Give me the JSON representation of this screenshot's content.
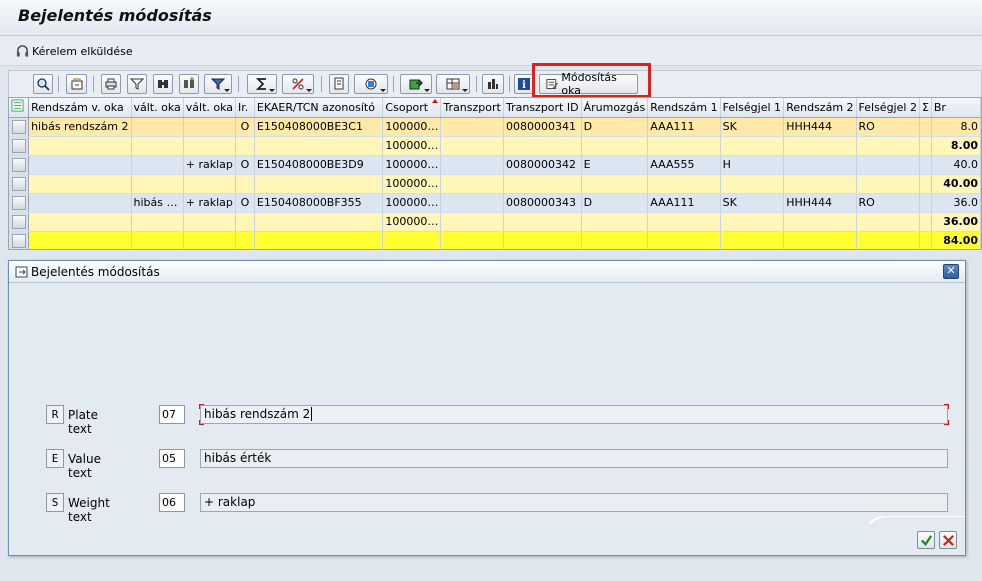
{
  "window": {
    "title": "Bejelentés módosítás"
  },
  "app_toolbar": {
    "send_request": "Kérelem elküldése"
  },
  "alv_toolbar": {
    "modify_reason_button": "Módosítás oka"
  },
  "grid": {
    "columns": [
      "Rendszám v. oka",
      "vált. oka",
      "vált. oka",
      "Ir.",
      "EKAER/TCN azonosító",
      "Csoport",
      "Transzport",
      "Transzport ID",
      "Árumozgás",
      "Rendszám 1",
      "Felségjel 1",
      "Rendszám 2",
      "Felségjel 2",
      "Σ",
      "Br"
    ],
    "rows": [
      {
        "type": "data",
        "current": true,
        "cells": [
          "hibás rendszám 2",
          "",
          "",
          "O",
          "E150408000BE3C1",
          "100000…",
          "",
          "0080000341",
          "D",
          "AAA111",
          "SK",
          "HHH444",
          "RO",
          "",
          "8.0"
        ]
      },
      {
        "type": "subtotal",
        "cells": [
          "",
          "",
          "",
          "",
          "",
          "100000…",
          "",
          "",
          "",
          "",
          "",
          "",
          "",
          "",
          "8.00"
        ]
      },
      {
        "type": "data",
        "cells": [
          "",
          "",
          "+ raklap",
          "O",
          "E150408000BE3D9",
          "100000…",
          "",
          "0080000342",
          "E",
          "AAA555",
          "H",
          "",
          "",
          "",
          "40.0"
        ]
      },
      {
        "type": "subtotal",
        "cells": [
          "",
          "",
          "",
          "",
          "",
          "100000…",
          "",
          "",
          "",
          "",
          "",
          "",
          "",
          "",
          "40.00"
        ]
      },
      {
        "type": "data",
        "cells": [
          "",
          "hibás …",
          "+ raklap",
          "O",
          "E150408000BF355",
          "100000…",
          "",
          "0080000343",
          "D",
          "AAA111",
          "SK",
          "HHH444",
          "RO",
          "",
          "36.0"
        ]
      },
      {
        "type": "subtotal",
        "cells": [
          "",
          "",
          "",
          "",
          "",
          "100000…",
          "",
          "",
          "",
          "",
          "",
          "",
          "",
          "",
          "36.00"
        ]
      },
      {
        "type": "total",
        "cells": [
          "",
          "",
          "",
          "",
          "",
          "",
          "",
          "",
          "",
          "",
          "",
          "",
          "",
          "",
          "84.00"
        ]
      }
    ]
  },
  "dialog": {
    "title": "Bejelentés módosítás",
    "fields": [
      {
        "code": "R",
        "label": "Plate text",
        "number": "07",
        "text": "hibás rendszám 2"
      },
      {
        "code": "E",
        "label": "Value text",
        "number": "05",
        "text": "hibás érték"
      },
      {
        "code": "S",
        "label": "Weight text",
        "number": "06",
        "text": "+ raklap"
      }
    ]
  },
  "colors": {
    "highlight": "#e0201e",
    "subtotal_row": "#fff6b8",
    "total_row": "#ffff33",
    "current_row": "#ffe9a8",
    "data_row": "#dce6f3"
  }
}
